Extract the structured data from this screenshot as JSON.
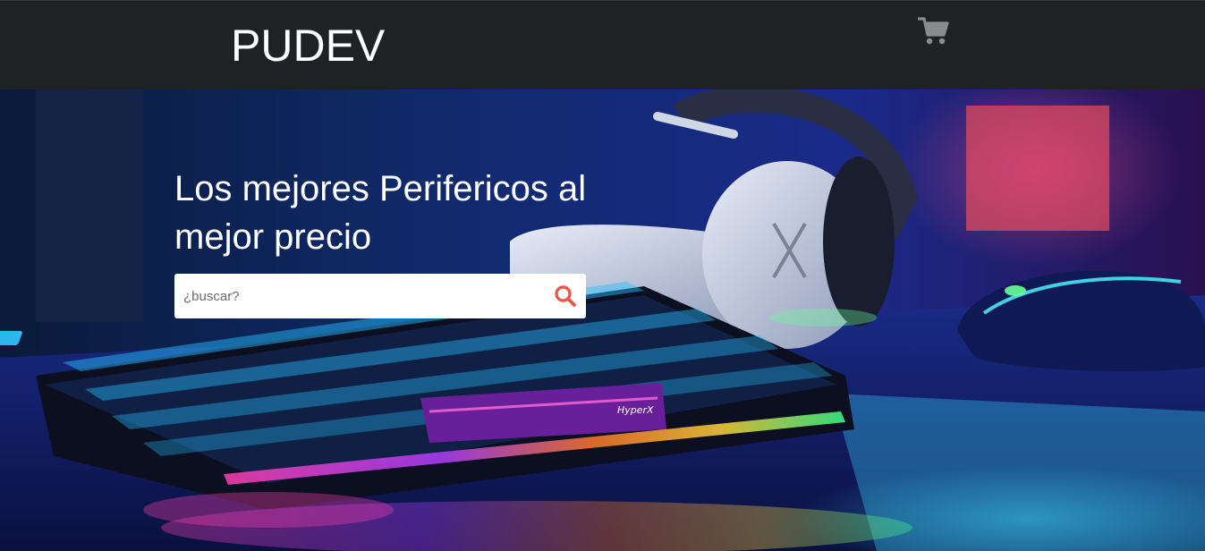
{
  "navbar": {
    "brand": "PUDEV",
    "cart_icon": "shopping-cart-icon"
  },
  "hero": {
    "title": "Los mejores Perifericos al mejor precio",
    "search": {
      "placeholder": "¿buscar?",
      "value": "",
      "icon": "search-icon",
      "icon_color": "#e8574a"
    },
    "background_image": "gaming-keyboard-headset-mouse-photo",
    "keyboard_label": "HyperX"
  },
  "colors": {
    "navbar_bg": "#1f2224",
    "brand_text": "#ffffff",
    "cart_icon": "#8a8d90"
  }
}
